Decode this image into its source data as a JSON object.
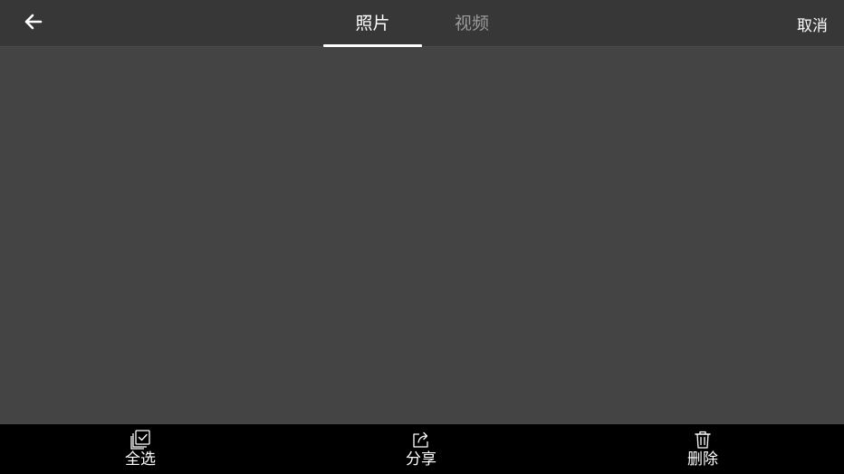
{
  "header": {
    "back_icon": "arrow-left-icon",
    "tabs": [
      {
        "label": "照片",
        "active": true
      },
      {
        "label": "视频",
        "active": false
      }
    ],
    "cancel_label": "取消"
  },
  "content": {
    "items": []
  },
  "toolbar": {
    "actions": [
      {
        "label": "全选",
        "icon": "select-all-icon"
      },
      {
        "label": "分享",
        "icon": "share-icon"
      },
      {
        "label": "删除",
        "icon": "trash-icon"
      }
    ]
  },
  "colors": {
    "topbar_bg": "#373737",
    "content_bg": "#444444",
    "bottombar_bg": "#000000",
    "active_tab": "#ffffff",
    "inactive_tab": "#9a9a9a"
  }
}
